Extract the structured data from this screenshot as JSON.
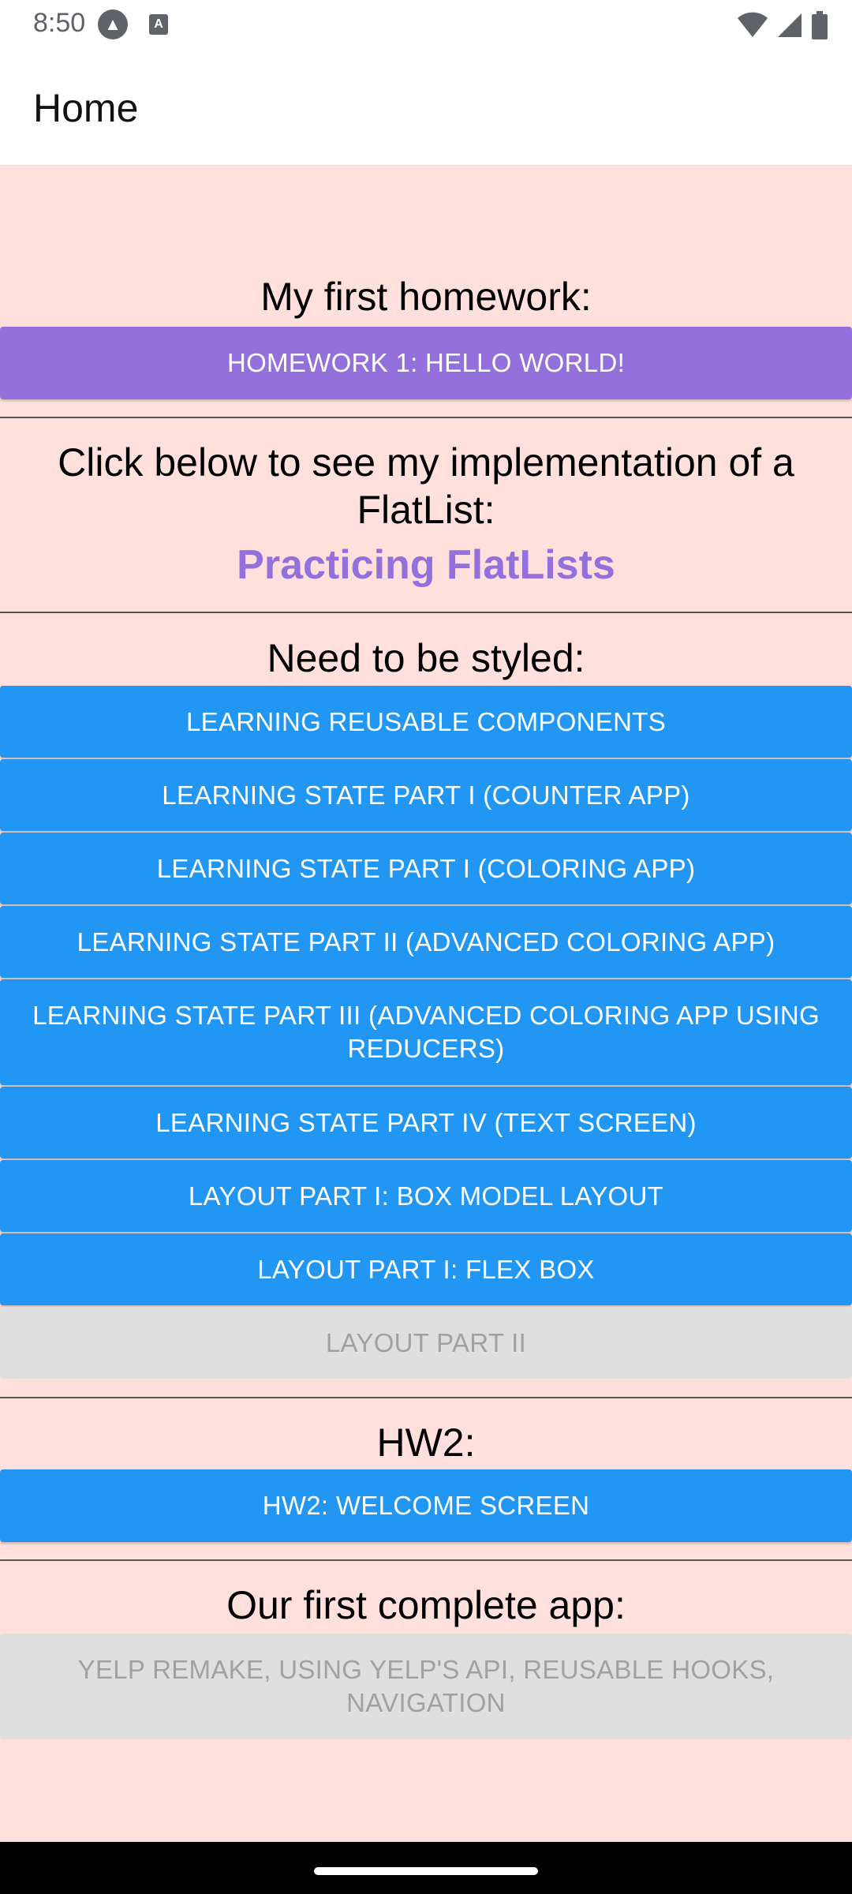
{
  "status_bar": {
    "time": "8:50",
    "icons": [
      "expo-icon",
      "a-icon",
      "wifi-icon",
      "signal-icon",
      "battery-icon"
    ],
    "icon_a_text": "A"
  },
  "header": {
    "title": "Home"
  },
  "sections": {
    "hw1": {
      "heading": "My first homework:",
      "button": "HOMEWORK 1: HELLO WORLD!"
    },
    "flatlist": {
      "line1": "Click below to see my implementation of a",
      "line2": "FlatList:",
      "link": "Practicing FlatLists"
    },
    "styled": {
      "heading": "Need to be styled:",
      "buttons": [
        "LEARNING REUSABLE COMPONENTS",
        "LEARNING STATE PART I (COUNTER APP)",
        "LEARNING STATE PART I (COLORING APP)",
        "LEARNING STATE PART II (ADVANCED COLORING APP)",
        "LEARNING STATE PART III (ADVANCED COLORING APP USING REDUCERS)",
        "LEARNING STATE PART IV (TEXT SCREEN)",
        "LAYOUT PART I: BOX MODEL LAYOUT",
        "LAYOUT PART I: FLEX BOX",
        "LAYOUT PART II"
      ]
    },
    "hw2": {
      "heading": "HW2:",
      "button": "HW2: WELCOME SCREEN"
    },
    "complete_app": {
      "heading": "Our first complete app:",
      "button": "YELP REMAKE, USING YELP'S API, REUSABLE HOOKS, NAVIGATION"
    }
  },
  "colors": {
    "background": "#ffe0dc",
    "primary_button": "#2196f3",
    "accent_button": "#9370db",
    "disabled_button": "#dfdfdf",
    "disabled_text": "#a1a1a1"
  }
}
